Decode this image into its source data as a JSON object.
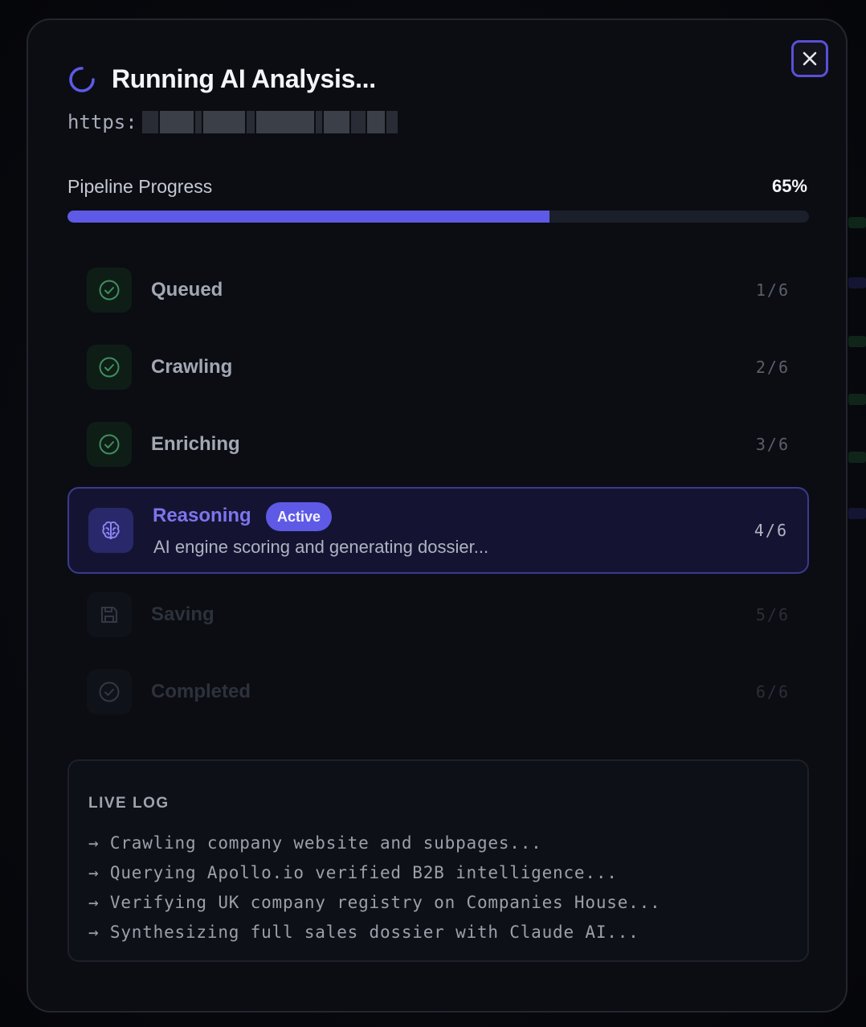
{
  "dialog": {
    "title": "Running AI Analysis...",
    "url_prefix": "https:",
    "close_icon": "close-icon",
    "spinner_icon": "spinner-icon"
  },
  "progress": {
    "label": "Pipeline Progress",
    "value_text": "65%",
    "fraction": 0.65
  },
  "steps": [
    {
      "label": "Queued",
      "count": "1/6",
      "status": "done",
      "icon": "check-circle-icon"
    },
    {
      "label": "Crawling",
      "count": "2/6",
      "status": "done",
      "icon": "check-circle-icon"
    },
    {
      "label": "Enriching",
      "count": "3/6",
      "status": "done",
      "icon": "check-circle-icon"
    },
    {
      "label": "Reasoning",
      "count": "4/6",
      "status": "active",
      "icon": "brain-icon",
      "badge": "Active",
      "description": "AI engine scoring and generating dossier..."
    },
    {
      "label": "Saving",
      "count": "5/6",
      "status": "pending",
      "icon": "save-icon"
    },
    {
      "label": "Completed",
      "count": "6/6",
      "status": "pending",
      "icon": "check-circle-icon"
    }
  ],
  "log": {
    "title": "LIVE LOG",
    "lines": [
      "→ Crawling company website and subpages...",
      "→ Querying Apollo.io verified B2B intelligence...",
      "→ Verifying UK company registry on Companies House...",
      "→ Synthesizing full sales dossier with Claude AI..."
    ]
  },
  "colors": {
    "accent": "#5e5ae6",
    "done_green": "#3f8f5c",
    "background": "#0b0d13"
  }
}
